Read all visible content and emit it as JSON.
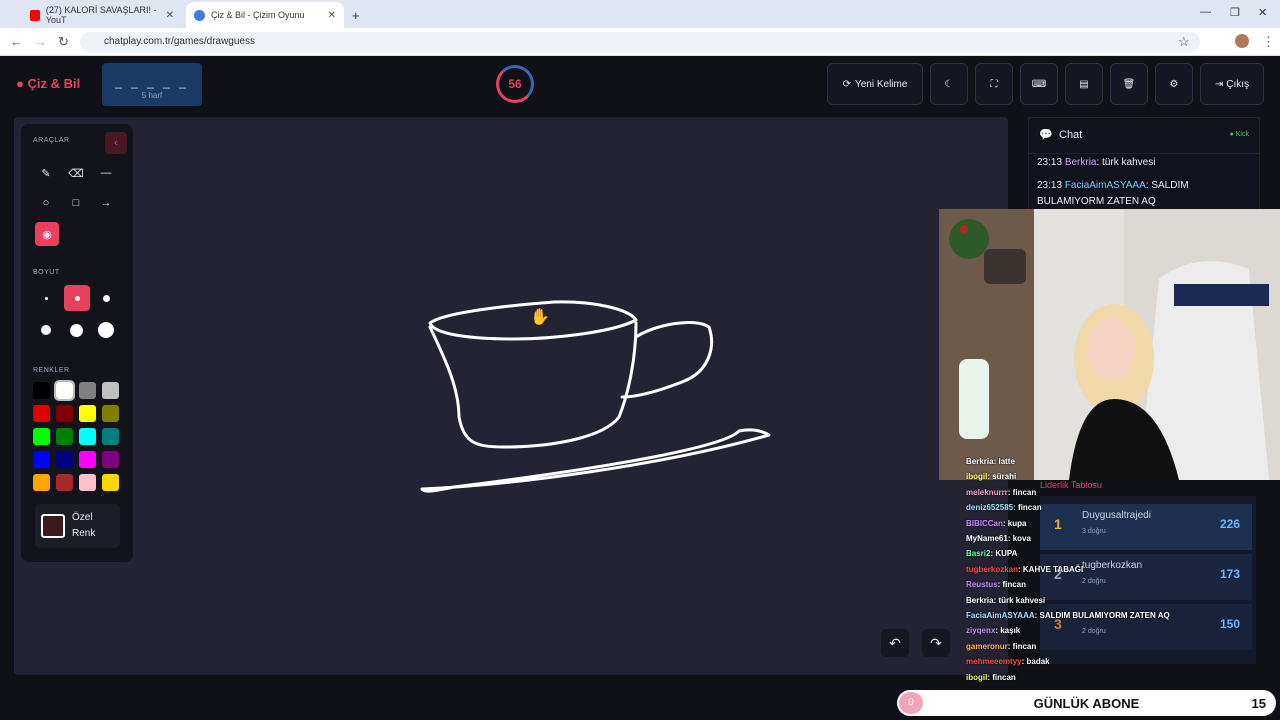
{
  "browser": {
    "tabs": [
      {
        "title": "(27) KALORİ SAVAŞLARI! - YouT",
        "active": false,
        "favicon_color": "#ff0000"
      },
      {
        "title": "Çiz & Bil - Çizim Oyunu",
        "active": true,
        "favicon_color": "#3d7bd6"
      }
    ],
    "url": "chatplay.com.tr/games/drawguess"
  },
  "header": {
    "logo": "Çiz & Bil",
    "word_mask": "_ _ _ _ _",
    "word_length": "5 harf",
    "timer": "56",
    "buttons": {
      "new_word": "Yeni Kelime",
      "exit": "Çıkış"
    }
  },
  "tools": {
    "section_tools": "ARAÇLAR",
    "section_size": "BOYUT",
    "section_colors": "RENKLER",
    "custom_color_label": "Özel Renk",
    "colors": [
      "#000000",
      "#ffffff",
      "#808080",
      "#c0c0c0",
      "#e00000",
      "#800000",
      "#ffff00",
      "#808000",
      "#00ff00",
      "#008000",
      "#00ffff",
      "#008080",
      "#0000ff",
      "#000080",
      "#ff00ff",
      "#800080",
      "#ffa500",
      "#a52a2a",
      "#ffc0cb",
      "#ffd700"
    ]
  },
  "chat": {
    "title": "Chat",
    "status": "Kick",
    "messages": [
      {
        "time": "23:13",
        "user": "Berkria",
        "text": ": türk kahvesi"
      },
      {
        "time": "23:13",
        "user": "FaciaAimASYAAA",
        "text": ": SALDIM BULAMIYORM ZATEN AQ"
      }
    ]
  },
  "overlay": {
    "leaderboard_title": "Liderlik Tablosu",
    "leaderboard": [
      {
        "rank": "1",
        "name": "Duygusaltrajedi",
        "correct": "3 doğru",
        "score": "226"
      },
      {
        "rank": "2",
        "name": "tugberkozkan",
        "correct": "2 doğru",
        "score": "173"
      },
      {
        "rank": "3",
        "name": "",
        "correct": "2 doğru",
        "score": "150"
      }
    ],
    "stream_chat": [
      {
        "user": "Berkria",
        "text": ": latte",
        "color": "#ffffff"
      },
      {
        "user": "ibogil",
        "text": ": sürahi",
        "color": "#ffff66"
      },
      {
        "user": "meleknurrr",
        "text": ": fincan",
        "color": "#ff9ec8"
      },
      {
        "user": "deniz652585",
        "text": ": fincan",
        "color": "#9be3ff"
      },
      {
        "user": "BIBICCan",
        "text": ": kupa",
        "color": "#c58cff"
      },
      {
        "user": "MyName61",
        "text": ": kova",
        "color": "#ffffff"
      },
      {
        "user": "Basri2",
        "text": ": KUPA",
        "color": "#6dff9e"
      },
      {
        "user": "tugberkozkan",
        "text": ": KAHVE TABAĞI",
        "color": "#ff4a4a"
      },
      {
        "user": "Reustus",
        "text": ": fincan",
        "color": "#c58cff"
      },
      {
        "user": "Berkria",
        "text": ": türk kahvesi",
        "color": "#ffffff"
      },
      {
        "user": "FaciaAimASYAAA",
        "text": ": SALDIM BULAMIYORM ZATEN AQ",
        "color": "#9be3ff"
      },
      {
        "user": "ziyqenx",
        "text": ": kaşık",
        "color": "#c58cff"
      },
      {
        "user": "gameronur",
        "text": ": fincan",
        "color": "#ffb347"
      },
      {
        "user": "mehmeeemtyy",
        "text": ": badak",
        "color": "#ff4a4a"
      },
      {
        "user": "ibogil",
        "text": ": fincan",
        "color": "#ffff66"
      }
    ],
    "sub_bar": {
      "count": "0",
      "label": "GÜNLÜK ABONE",
      "goal": "15"
    }
  }
}
